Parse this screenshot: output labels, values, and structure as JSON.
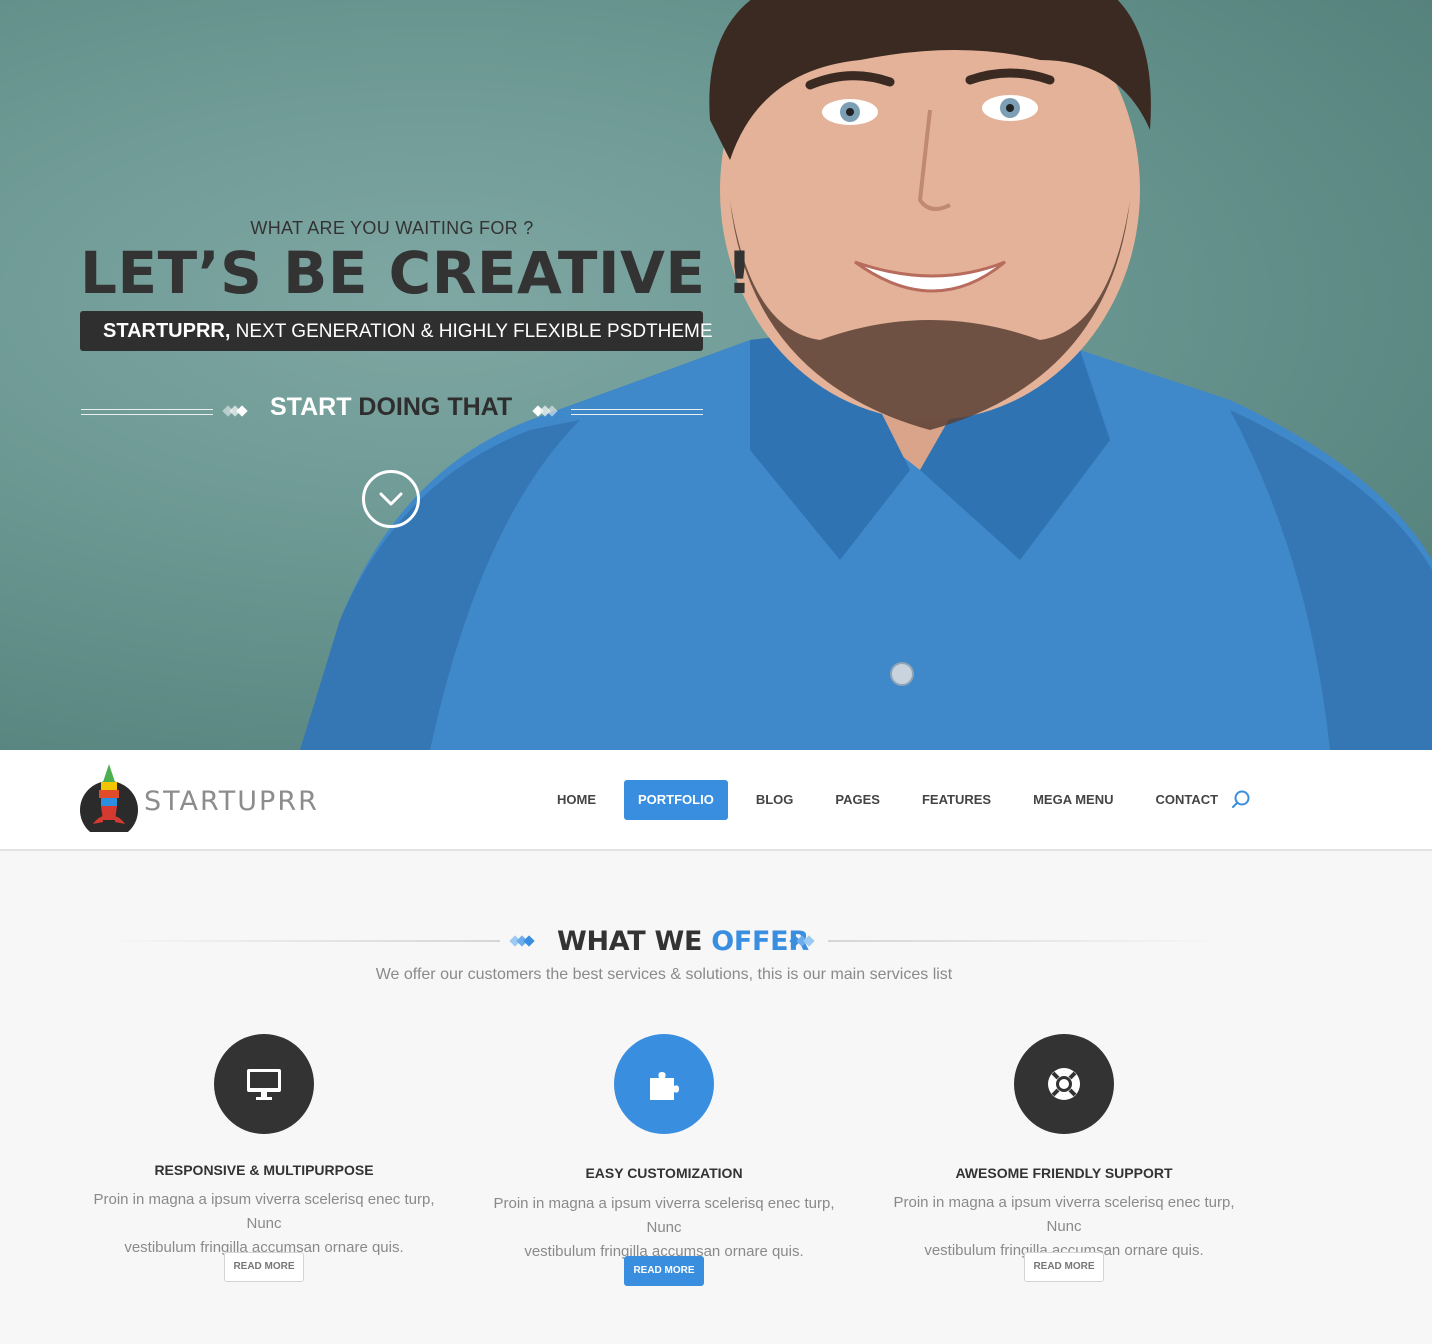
{
  "hero": {
    "eyebrow": "WHAT ARE YOU WAITING FOR ?",
    "title": "LET’S BE CREATIVE !",
    "bar_brand": "STARTUPRR,",
    "bar_text": " NEXT GENERATION & HIGHLY FLEXIBLE PSDTHEME",
    "cta_light": "START",
    "cta_dark": " DOING THAT"
  },
  "nav": {
    "logo_text": "STARTUPRR",
    "items": [
      {
        "label": "HOME",
        "active": false
      },
      {
        "label": "PORTFOLIO",
        "active": true
      },
      {
        "label": "BLOG",
        "active": false
      },
      {
        "label": "PAGES",
        "active": false
      },
      {
        "label": "FEATURES",
        "active": false
      },
      {
        "label": "MEGA MENU",
        "active": false
      },
      {
        "label": "CONTACT",
        "active": false
      }
    ]
  },
  "offer": {
    "title_dark": "WHAT WE ",
    "title_accent": "OFFER",
    "subtitle": "We offer our customers the best services & solutions, this is our main services list"
  },
  "services": [
    {
      "icon": "monitor-icon",
      "title": "RESPONSIVE & MULTIPURPOSE",
      "line1": "Proin in magna a ipsum viverra scelerisq enec turp, Nunc",
      "line2": "vestibulum fringilla accumsan ornare quis.",
      "button": "READ MORE"
    },
    {
      "icon": "puzzle-icon",
      "title": "EASY CUSTOMIZATION",
      "line1": "Proin in magna a ipsum viverra scelerisq enec turp, Nunc",
      "line2": "vestibulum fringilla accumsan ornare quis.",
      "button": "READ MORE"
    },
    {
      "icon": "lifebuoy-icon",
      "title": "AWESOME FRIENDLY SUPPORT",
      "line1": "Proin in magna a ipsum viverra scelerisq enec turp, Nunc",
      "line2": "vestibulum fringilla accumsan ornare quis.",
      "button": "READ MORE"
    }
  ],
  "colors": {
    "accent": "#3a8ee0",
    "dark": "#333333",
    "hero_bg": "#6c9893",
    "shirt": "#3f88c9"
  }
}
